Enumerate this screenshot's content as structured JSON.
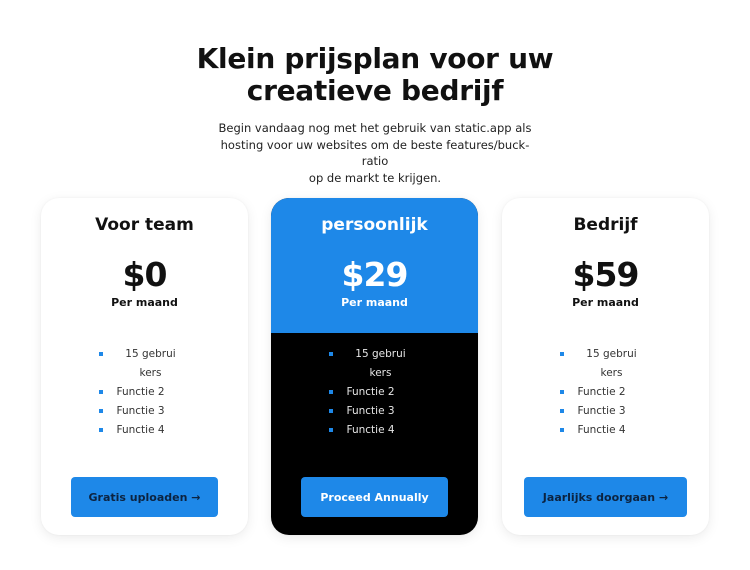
{
  "header": {
    "title_line1": "Klein prijsplan voor uw",
    "title_line2": "creatieve bedrijf",
    "subtitle_line1": "Begin vandaag nog met het gebruik van static.app als",
    "subtitle_line2": "hosting voor uw websites om de beste features/buck-ratio",
    "subtitle_line3": "op de markt te krijgen."
  },
  "colors": {
    "accent": "#1e88e8",
    "featured_body": "#000000",
    "text": "#111111"
  },
  "plans": [
    {
      "name": "Voor team",
      "price": "$0",
      "period": "Per maand",
      "features": [
        "15 gebruikers",
        "Functie 2",
        "Functie 3",
        "Functie 4"
      ],
      "cta": "Gratis uploaden →"
    },
    {
      "name": "persoonlijk",
      "price": "$29",
      "period": "Per maand",
      "features": [
        "15 gebruikers",
        "Functie 2",
        "Functie 3",
        "Functie 4"
      ],
      "cta": "Proceed Annually"
    },
    {
      "name": "Bedrijf",
      "price": "$59",
      "period": "Per maand",
      "features": [
        "15 gebruikers",
        "Functie 2",
        "Functie 3",
        "Functie 4"
      ],
      "cta": "Jaarlijks doorgaan →"
    }
  ]
}
